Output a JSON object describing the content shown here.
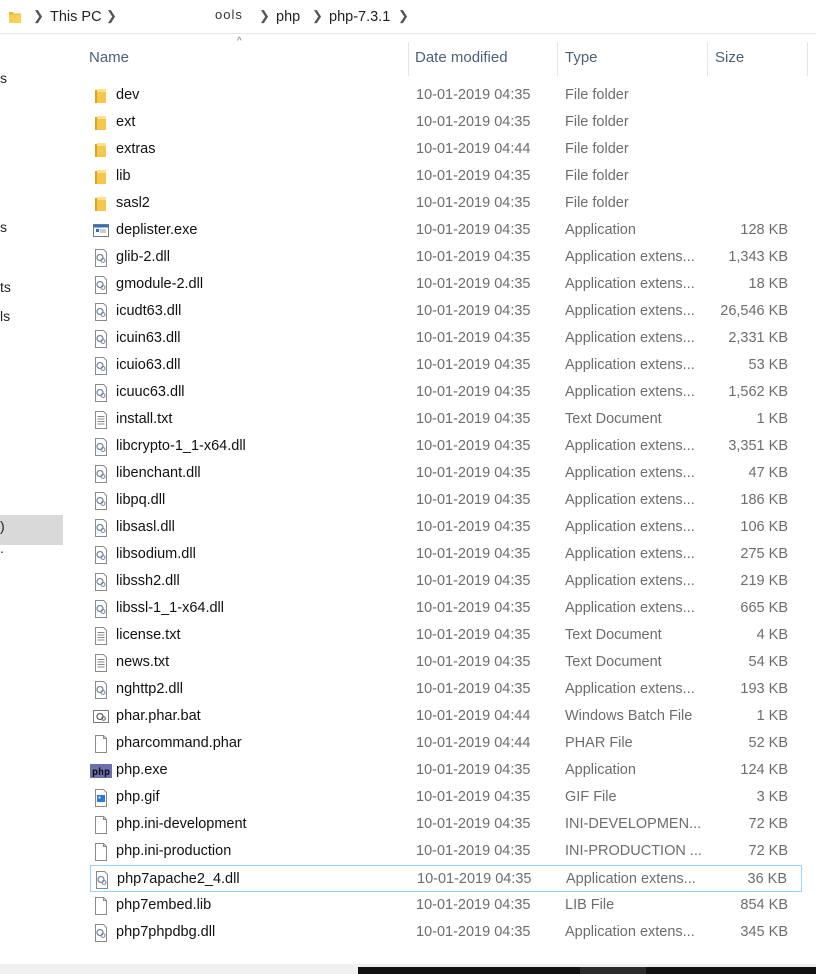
{
  "breadcrumb": {
    "items": [
      "This PC",
      "ools",
      "php",
      "php-7.3.1"
    ]
  },
  "nav_fragments": [
    "s",
    "s",
    "ts",
    "ls",
    ")",
    "."
  ],
  "columns": {
    "name": "Name",
    "date": "Date modified",
    "type": "Type",
    "size": "Size"
  },
  "sort_indicator": "^",
  "files": [
    {
      "name": "dev",
      "date": "10-01-2019 04:35",
      "type": "File folder",
      "size": "",
      "icon": "folder-icon"
    },
    {
      "name": "ext",
      "date": "10-01-2019 04:35",
      "type": "File folder",
      "size": "",
      "icon": "folder-icon"
    },
    {
      "name": "extras",
      "date": "10-01-2019 04:44",
      "type": "File folder",
      "size": "",
      "icon": "folder-icon"
    },
    {
      "name": "lib",
      "date": "10-01-2019 04:35",
      "type": "File folder",
      "size": "",
      "icon": "folder-icon"
    },
    {
      "name": "sasl2",
      "date": "10-01-2019 04:35",
      "type": "File folder",
      "size": "",
      "icon": "folder-icon"
    },
    {
      "name": "deplister.exe",
      "date": "10-01-2019 04:35",
      "type": "Application",
      "size": "128 KB",
      "icon": "exe-icon"
    },
    {
      "name": "glib-2.dll",
      "date": "10-01-2019 04:35",
      "type": "Application extens...",
      "size": "1,343 KB",
      "icon": "dll-icon"
    },
    {
      "name": "gmodule-2.dll",
      "date": "10-01-2019 04:35",
      "type": "Application extens...",
      "size": "18 KB",
      "icon": "dll-icon"
    },
    {
      "name": "icudt63.dll",
      "date": "10-01-2019 04:35",
      "type": "Application extens...",
      "size": "26,546 KB",
      "icon": "dll-icon"
    },
    {
      "name": "icuin63.dll",
      "date": "10-01-2019 04:35",
      "type": "Application extens...",
      "size": "2,331 KB",
      "icon": "dll-icon"
    },
    {
      "name": "icuio63.dll",
      "date": "10-01-2019 04:35",
      "type": "Application extens...",
      "size": "53 KB",
      "icon": "dll-icon"
    },
    {
      "name": "icuuc63.dll",
      "date": "10-01-2019 04:35",
      "type": "Application extens...",
      "size": "1,562 KB",
      "icon": "dll-icon"
    },
    {
      "name": "install.txt",
      "date": "10-01-2019 04:35",
      "type": "Text Document",
      "size": "1 KB",
      "icon": "text-file-icon"
    },
    {
      "name": "libcrypto-1_1-x64.dll",
      "date": "10-01-2019 04:35",
      "type": "Application extens...",
      "size": "3,351 KB",
      "icon": "dll-icon"
    },
    {
      "name": "libenchant.dll",
      "date": "10-01-2019 04:35",
      "type": "Application extens...",
      "size": "47 KB",
      "icon": "dll-icon"
    },
    {
      "name": "libpq.dll",
      "date": "10-01-2019 04:35",
      "type": "Application extens...",
      "size": "186 KB",
      "icon": "dll-icon"
    },
    {
      "name": "libsasl.dll",
      "date": "10-01-2019 04:35",
      "type": "Application extens...",
      "size": "106 KB",
      "icon": "dll-icon"
    },
    {
      "name": "libsodium.dll",
      "date": "10-01-2019 04:35",
      "type": "Application extens...",
      "size": "275 KB",
      "icon": "dll-icon"
    },
    {
      "name": "libssh2.dll",
      "date": "10-01-2019 04:35",
      "type": "Application extens...",
      "size": "219 KB",
      "icon": "dll-icon"
    },
    {
      "name": "libssl-1_1-x64.dll",
      "date": "10-01-2019 04:35",
      "type": "Application extens...",
      "size": "665 KB",
      "icon": "dll-icon"
    },
    {
      "name": "license.txt",
      "date": "10-01-2019 04:35",
      "type": "Text Document",
      "size": "4 KB",
      "icon": "text-file-icon"
    },
    {
      "name": "news.txt",
      "date": "10-01-2019 04:35",
      "type": "Text Document",
      "size": "54 KB",
      "icon": "text-file-icon"
    },
    {
      "name": "nghttp2.dll",
      "date": "10-01-2019 04:35",
      "type": "Application extens...",
      "size": "193 KB",
      "icon": "dll-icon"
    },
    {
      "name": "phar.phar.bat",
      "date": "10-01-2019 04:44",
      "type": "Windows Batch File",
      "size": "1 KB",
      "icon": "batch-file-icon"
    },
    {
      "name": "pharcommand.phar",
      "date": "10-01-2019 04:44",
      "type": "PHAR File",
      "size": "52 KB",
      "icon": "blank-file-icon"
    },
    {
      "name": "php.exe",
      "date": "10-01-2019 04:35",
      "type": "Application",
      "size": "124 KB",
      "icon": "php-icon"
    },
    {
      "name": "php.gif",
      "date": "10-01-2019 04:35",
      "type": "GIF File",
      "size": "3 KB",
      "icon": "image-file-icon"
    },
    {
      "name": "php.ini-development",
      "date": "10-01-2019 04:35",
      "type": "INI-DEVELOPMEN...",
      "size": "72 KB",
      "icon": "blank-file-icon"
    },
    {
      "name": "php.ini-production",
      "date": "10-01-2019 04:35",
      "type": "INI-PRODUCTION ...",
      "size": "72 KB",
      "icon": "blank-file-icon"
    },
    {
      "name": "php7apache2_4.dll",
      "date": "10-01-2019 04:35",
      "type": "Application extens...",
      "size": "36 KB",
      "icon": "dll-icon",
      "outlined": true
    },
    {
      "name": "php7embed.lib",
      "date": "10-01-2019 04:35",
      "type": "LIB File",
      "size": "854 KB",
      "icon": "blank-file-icon"
    },
    {
      "name": "php7phpdbg.dll",
      "date": "10-01-2019 04:35",
      "type": "Application extens...",
      "size": "345 KB",
      "icon": "dll-icon"
    }
  ],
  "php_icon_text": "php"
}
